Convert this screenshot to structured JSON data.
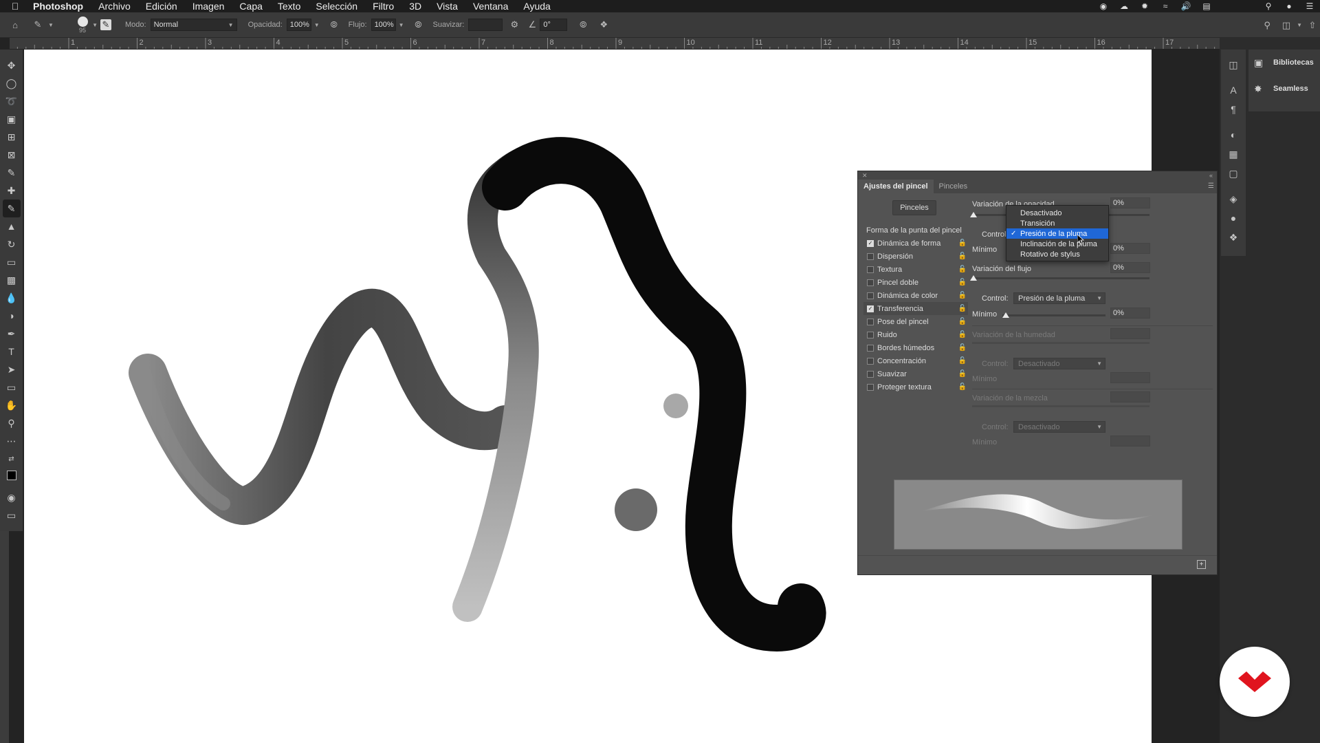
{
  "menubar": {
    "apple_icon": "apple-icon",
    "app_name": "Photoshop",
    "items": [
      "Archivo",
      "Edición",
      "Imagen",
      "Capa",
      "Texto",
      "Selección",
      "Filtro",
      "3D",
      "Vista",
      "Ventana",
      "Ayuda"
    ]
  },
  "options_bar": {
    "brush_size": "95",
    "mode_label": "Modo:",
    "mode_value": "Normal",
    "opacity_label": "Opacidad:",
    "opacity_value": "100%",
    "flow_label": "Flujo:",
    "flow_value": "100%",
    "smoothing_label": "Suavizar:",
    "smoothing_value": "",
    "angle_value": "0°"
  },
  "ruler": {
    "numbers": [
      "1",
      "2",
      "3",
      "4",
      "5",
      "6",
      "7",
      "8",
      "9",
      "10",
      "11",
      "12",
      "13",
      "14",
      "15",
      "16",
      "17"
    ]
  },
  "right_panels": {
    "libraries": "Bibliotecas",
    "seamless": "Seamless"
  },
  "brush_panel": {
    "tab_active": "Ajustes del pincel",
    "tab_other": "Pinceles",
    "brushes_button": "Pinceles",
    "list_header": "Forma de la punta del pincel",
    "list": [
      {
        "label": "Dinámica de forma",
        "checked": true,
        "selected": false
      },
      {
        "label": "Dispersión",
        "checked": false,
        "selected": false
      },
      {
        "label": "Textura",
        "checked": false,
        "selected": false
      },
      {
        "label": "Pincel doble",
        "checked": false,
        "selected": false
      },
      {
        "label": "Dinámica de color",
        "checked": false,
        "selected": false
      },
      {
        "label": "Transferencia",
        "checked": true,
        "selected": true
      },
      {
        "label": "Pose del pincel",
        "checked": false,
        "selected": false
      },
      {
        "label": "Ruido",
        "checked": false,
        "selected": false
      },
      {
        "label": "Bordes húmedos",
        "checked": false,
        "selected": false
      },
      {
        "label": "Concentración",
        "checked": false,
        "selected": false
      },
      {
        "label": "Suavizar",
        "checked": false,
        "selected": false
      },
      {
        "label": "Proteger textura",
        "checked": false,
        "selected": false
      }
    ],
    "opacity_variation_label": "Variación de la opacidad",
    "opacity_variation_value": "0%",
    "control_label_1": "Control:",
    "minimum_label_1": "Mínimo",
    "minimum_value_1": "0%",
    "flow_variation_label": "Variación del flujo",
    "flow_variation_value": "0%",
    "control_label_2": "Control:",
    "control_value_2": "Presión de la pluma",
    "minimum_label_2": "Mínimo",
    "minimum_value_2": "0%",
    "wetness_variation_label": "Variación de la humedad",
    "control_label_3": "Control:",
    "control_value_3": "Desactivado",
    "minimum_label_3": "Mínimo",
    "mix_variation_label": "Variación de la mezcla",
    "control_label_4": "Control:",
    "control_value_4": "Desactivado",
    "minimum_label_4": "Mínimo"
  },
  "dropdown": {
    "options": [
      "Desactivado",
      "Transición",
      "Presión de la pluma",
      "Inclinación de la pluma",
      "Rotativo de stylus"
    ],
    "selected_index": 2
  },
  "colors": {
    "accent": "#1f67d6",
    "logo_red": "#e0141e"
  }
}
